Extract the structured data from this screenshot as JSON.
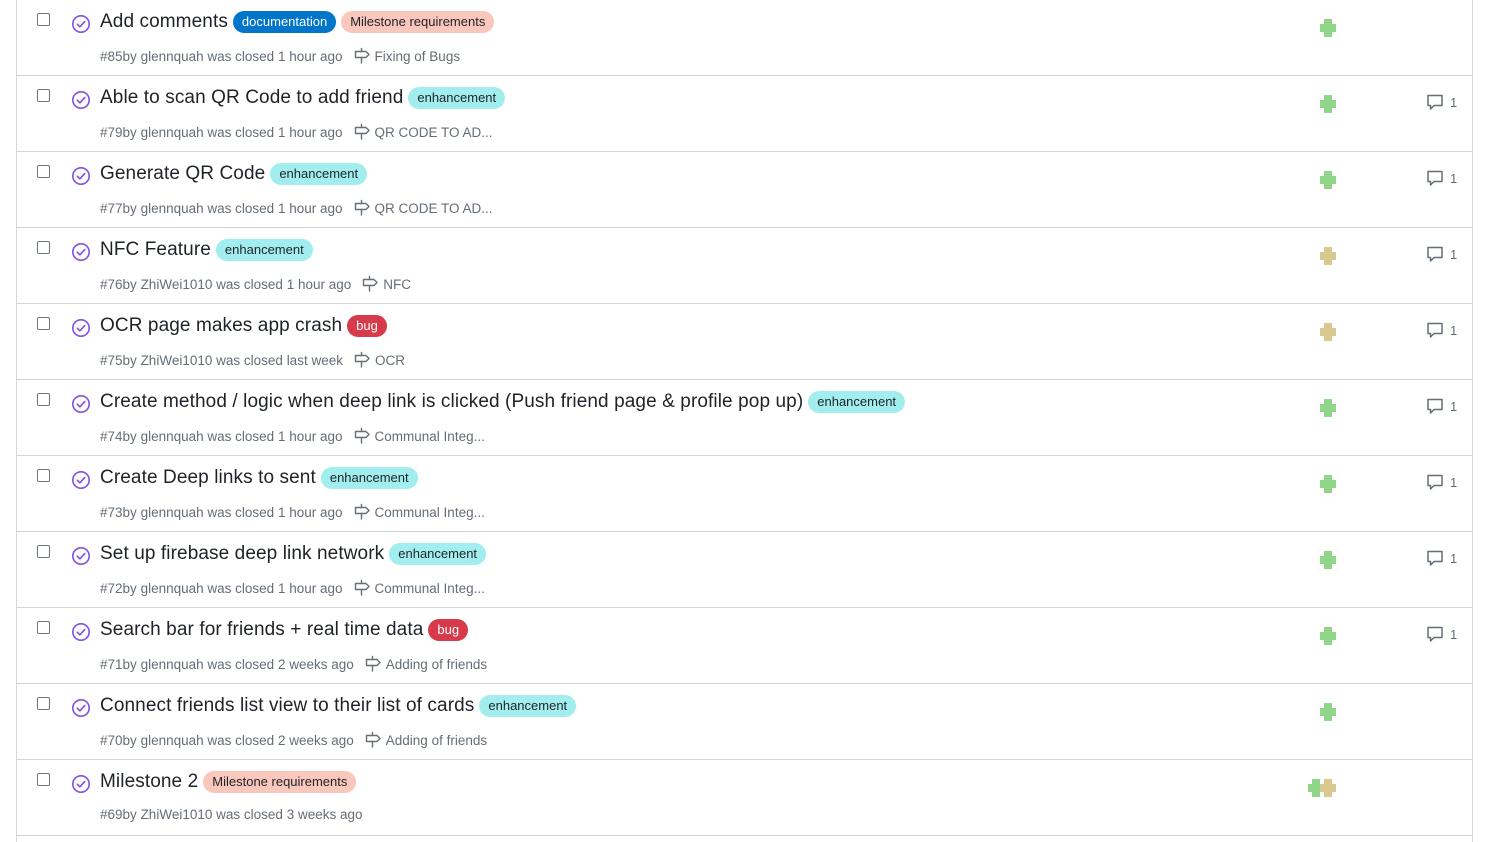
{
  "colors": {
    "closed_icon": "#8250df",
    "documentation": "#0075ca",
    "milestone_requirements": "#f9c7bb",
    "enhancement": "#a2eeef",
    "bug": "#d73a4a",
    "avatar_green": "#8fd68a",
    "avatar_tan": "#d9c98f"
  },
  "issues": [
    {
      "title": "Add comments",
      "labels": [
        {
          "text": "documentation",
          "kind": "documentation"
        },
        {
          "text": "Milestone requirements",
          "kind": "milestone_requirements"
        }
      ],
      "number": "#85",
      "author": "glennquah",
      "closed": "1 hour ago",
      "milestone": "Fixing of Bugs",
      "avatar": "green",
      "comments": ""
    },
    {
      "title": "Able to scan QR Code to add friend",
      "labels": [
        {
          "text": "enhancement",
          "kind": "enhancement"
        }
      ],
      "number": "#79",
      "author": "glennquah",
      "closed": "1 hour ago",
      "milestone": "QR CODE TO AD...",
      "avatar": "green",
      "comments": "1"
    },
    {
      "title": "Generate QR Code",
      "labels": [
        {
          "text": "enhancement",
          "kind": "enhancement"
        }
      ],
      "number": "#77",
      "author": "glennquah",
      "closed": "1 hour ago",
      "milestone": "QR CODE TO AD...",
      "avatar": "green",
      "comments": "1"
    },
    {
      "title": "NFC Feature",
      "labels": [
        {
          "text": "enhancement",
          "kind": "enhancement"
        }
      ],
      "number": "#76",
      "author": "ZhiWei1010",
      "closed": "1 hour ago",
      "milestone": "NFC",
      "avatar": "tan",
      "comments": "1"
    },
    {
      "title": "OCR page makes app crash",
      "labels": [
        {
          "text": "bug",
          "kind": "bug"
        }
      ],
      "number": "#75",
      "author": "ZhiWei1010",
      "closed": "last week",
      "milestone": "OCR",
      "avatar": "tan",
      "comments": "1"
    },
    {
      "title": "Create method / logic when deep link is clicked (Push friend page & profile pop up)",
      "labels": [
        {
          "text": "enhancement",
          "kind": "enhancement"
        }
      ],
      "number": "#74",
      "author": "glennquah",
      "closed": "1 hour ago",
      "milestone": "Communal Integ...",
      "avatar": "green",
      "comments": "1"
    },
    {
      "title": "Create Deep links to sent",
      "labels": [
        {
          "text": "enhancement",
          "kind": "enhancement"
        }
      ],
      "number": "#73",
      "author": "glennquah",
      "closed": "1 hour ago",
      "milestone": "Communal Integ...",
      "avatar": "green",
      "comments": "1"
    },
    {
      "title": "Set up firebase deep link network",
      "labels": [
        {
          "text": "enhancement",
          "kind": "enhancement"
        }
      ],
      "number": "#72",
      "author": "glennquah",
      "closed": "1 hour ago",
      "milestone": "Communal Integ...",
      "avatar": "green",
      "comments": "1"
    },
    {
      "title": "Search bar for friends + real time data",
      "labels": [
        {
          "text": "bug",
          "kind": "bug"
        }
      ],
      "number": "#71",
      "author": "glennquah",
      "closed": "2 weeks ago",
      "milestone": "Adding of friends",
      "avatar": "green",
      "comments": "1"
    },
    {
      "title": "Connect friends list view to their list of cards",
      "labels": [
        {
          "text": "enhancement",
          "kind": "enhancement"
        }
      ],
      "number": "#70",
      "author": "glennquah",
      "closed": "2 weeks ago",
      "milestone": "Adding of friends",
      "avatar": "green",
      "comments": ""
    },
    {
      "title": "Milestone 2",
      "labels": [
        {
          "text": "Milestone requirements",
          "kind": "milestone_requirements"
        }
      ],
      "number": "#69",
      "author": "ZhiWei1010",
      "closed": "3 weeks ago",
      "milestone": "",
      "avatar": "both",
      "comments": ""
    }
  ],
  "text": {
    "by": "by",
    "was_closed": "was closed"
  }
}
